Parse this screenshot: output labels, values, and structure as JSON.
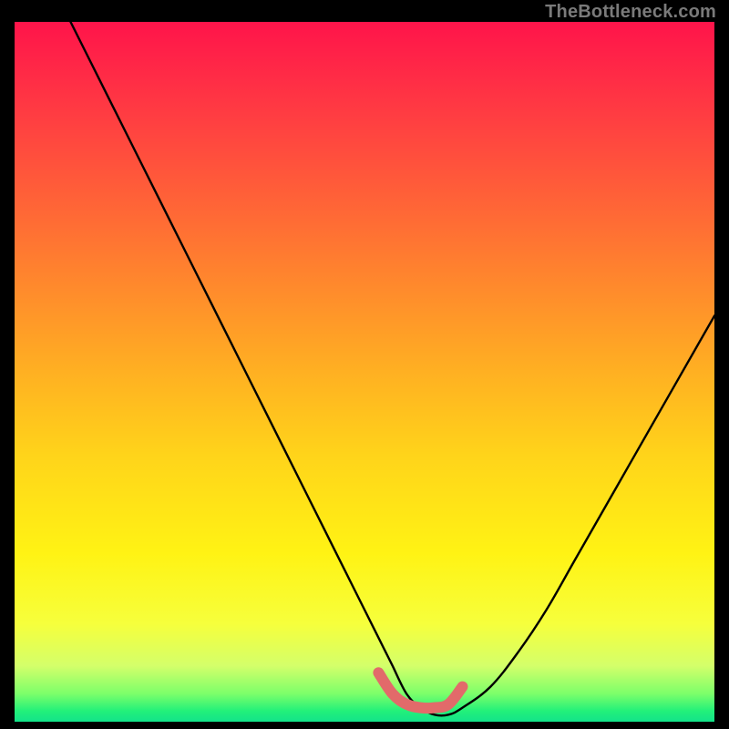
{
  "watermark": "TheBottleneck.com",
  "chart_data": {
    "type": "line",
    "title": "",
    "xlabel": "",
    "ylabel": "",
    "xlim": [
      0,
      100
    ],
    "ylim": [
      0,
      100
    ],
    "grid": false,
    "series": [
      {
        "name": "bottleneck-curve-black",
        "color": "#000000",
        "x": [
          8,
          12,
          16,
          20,
          24,
          28,
          32,
          36,
          40,
          44,
          48,
          52,
          53,
          54,
          56,
          58,
          60,
          62,
          64,
          68,
          72,
          76,
          80,
          84,
          88,
          92,
          96,
          100
        ],
        "y": [
          100,
          92,
          84,
          76,
          68,
          60,
          52,
          44,
          36,
          28,
          20,
          12,
          10,
          8,
          4,
          2,
          1,
          1,
          2,
          5,
          10,
          16,
          23,
          30,
          37,
          44,
          51,
          58
        ]
      },
      {
        "name": "bottleneck-floor-pink",
        "color": "#e26a6a",
        "x": [
          52,
          54,
          56,
          58,
          60,
          62,
          64
        ],
        "y": [
          7,
          4,
          2.5,
          2,
          2,
          2.5,
          5
        ]
      }
    ],
    "background_gradient": {
      "orientation": "vertical",
      "stops": [
        {
          "pos": 0.0,
          "color": "#ff144a"
        },
        {
          "pos": 0.5,
          "color": "#ffb022"
        },
        {
          "pos": 0.8,
          "color": "#fff314"
        },
        {
          "pos": 0.96,
          "color": "#7cff6a"
        },
        {
          "pos": 1.0,
          "color": "#13e38a"
        }
      ]
    }
  }
}
